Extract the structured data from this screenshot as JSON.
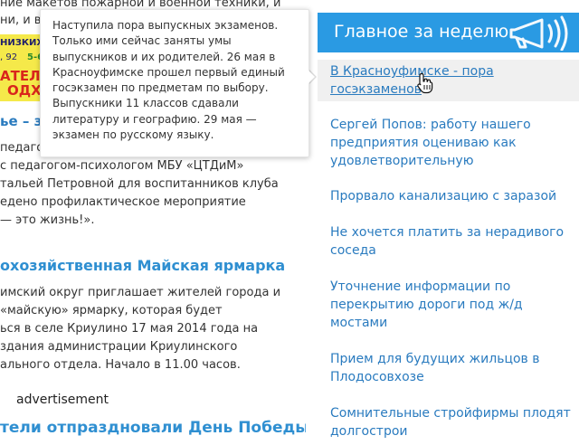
{
  "left": {
    "top_lines": [
      "ние макетов пожарной и военной техники, и",
      "ни, и в"
    ],
    "ad": {
      "line1": "НИЗКИХ",
      "line2_left": ", 92",
      "line2_right": "5-6",
      "line3": [
        "АТЕЛ",
        "ОДХ"
      ]
    },
    "article1": {
      "title_fragment": "ье – з",
      "lines": [
        "педаго",
        "с педагогом-психологом МБУ «ЦТДиМ»",
        "тальей Петровной для воспитанников клуба",
        "едено профилактическое мероприятие",
        "— это жизнь!»."
      ]
    },
    "article2": {
      "title": "охозяйственная Майская ярмарка",
      "lines": [
        "имский округ приглашает жителей города и",
        "«майскую» ярмарку, которая будет",
        "ься в селе Криулино 17 мая 2014 года на",
        "здания администрации Криулинского",
        "ального отдела. Начало в 11.00 часов."
      ]
    },
    "advertisement_label": "advertisement",
    "article3_title": "тели отпраздновали День Победы"
  },
  "tooltip": {
    "lines": [
      "Наступила пора выпускных экзаменов.",
      "Только ими сейчас заняты умы",
      "выпускников и их родителей. 26 мая в",
      "Красноуфимске прошел первый единый",
      "госэкзамен по предметам по выбору.",
      "Выпускники 11 классов сдавали",
      "литературу и географию. 29 мая —",
      "экзамен по русскому языку."
    ]
  },
  "sidebar": {
    "title": "Главное за неделю",
    "items": [
      {
        "lines": [
          "В Красноуфимске - пора",
          "госэкзаменов"
        ]
      },
      {
        "lines": [
          "Сергей Попов: работу нашего",
          "предприятия оцениваю как",
          "удовлетворительную"
        ]
      },
      {
        "lines": [
          "Прорвало канализацию с заразой"
        ]
      },
      {
        "lines": [
          "Не хочется платить за нерадивого",
          "соседа"
        ]
      },
      {
        "lines": [
          "Уточнение информации по",
          "перекрытию дороги под ж/д",
          "мостами"
        ]
      },
      {
        "lines": [
          "Прием для будущих жильцов в",
          "Плодосовхозе"
        ]
      },
      {
        "lines": [
          "Сомнительные стройфирмы плодят",
          "долгострои"
        ]
      }
    ]
  },
  "colors": {
    "sidebar_header": "#2a9ae3",
    "link": "#2a7bbf",
    "heading": "#2f8fd1",
    "ad_yellow": "#f5e94a",
    "ad_red": "#d9261c",
    "active_item_bg": "#f0f0f0"
  },
  "icons": {
    "header": "megaphone-icon",
    "cursor": "hand-pointer-icon"
  }
}
